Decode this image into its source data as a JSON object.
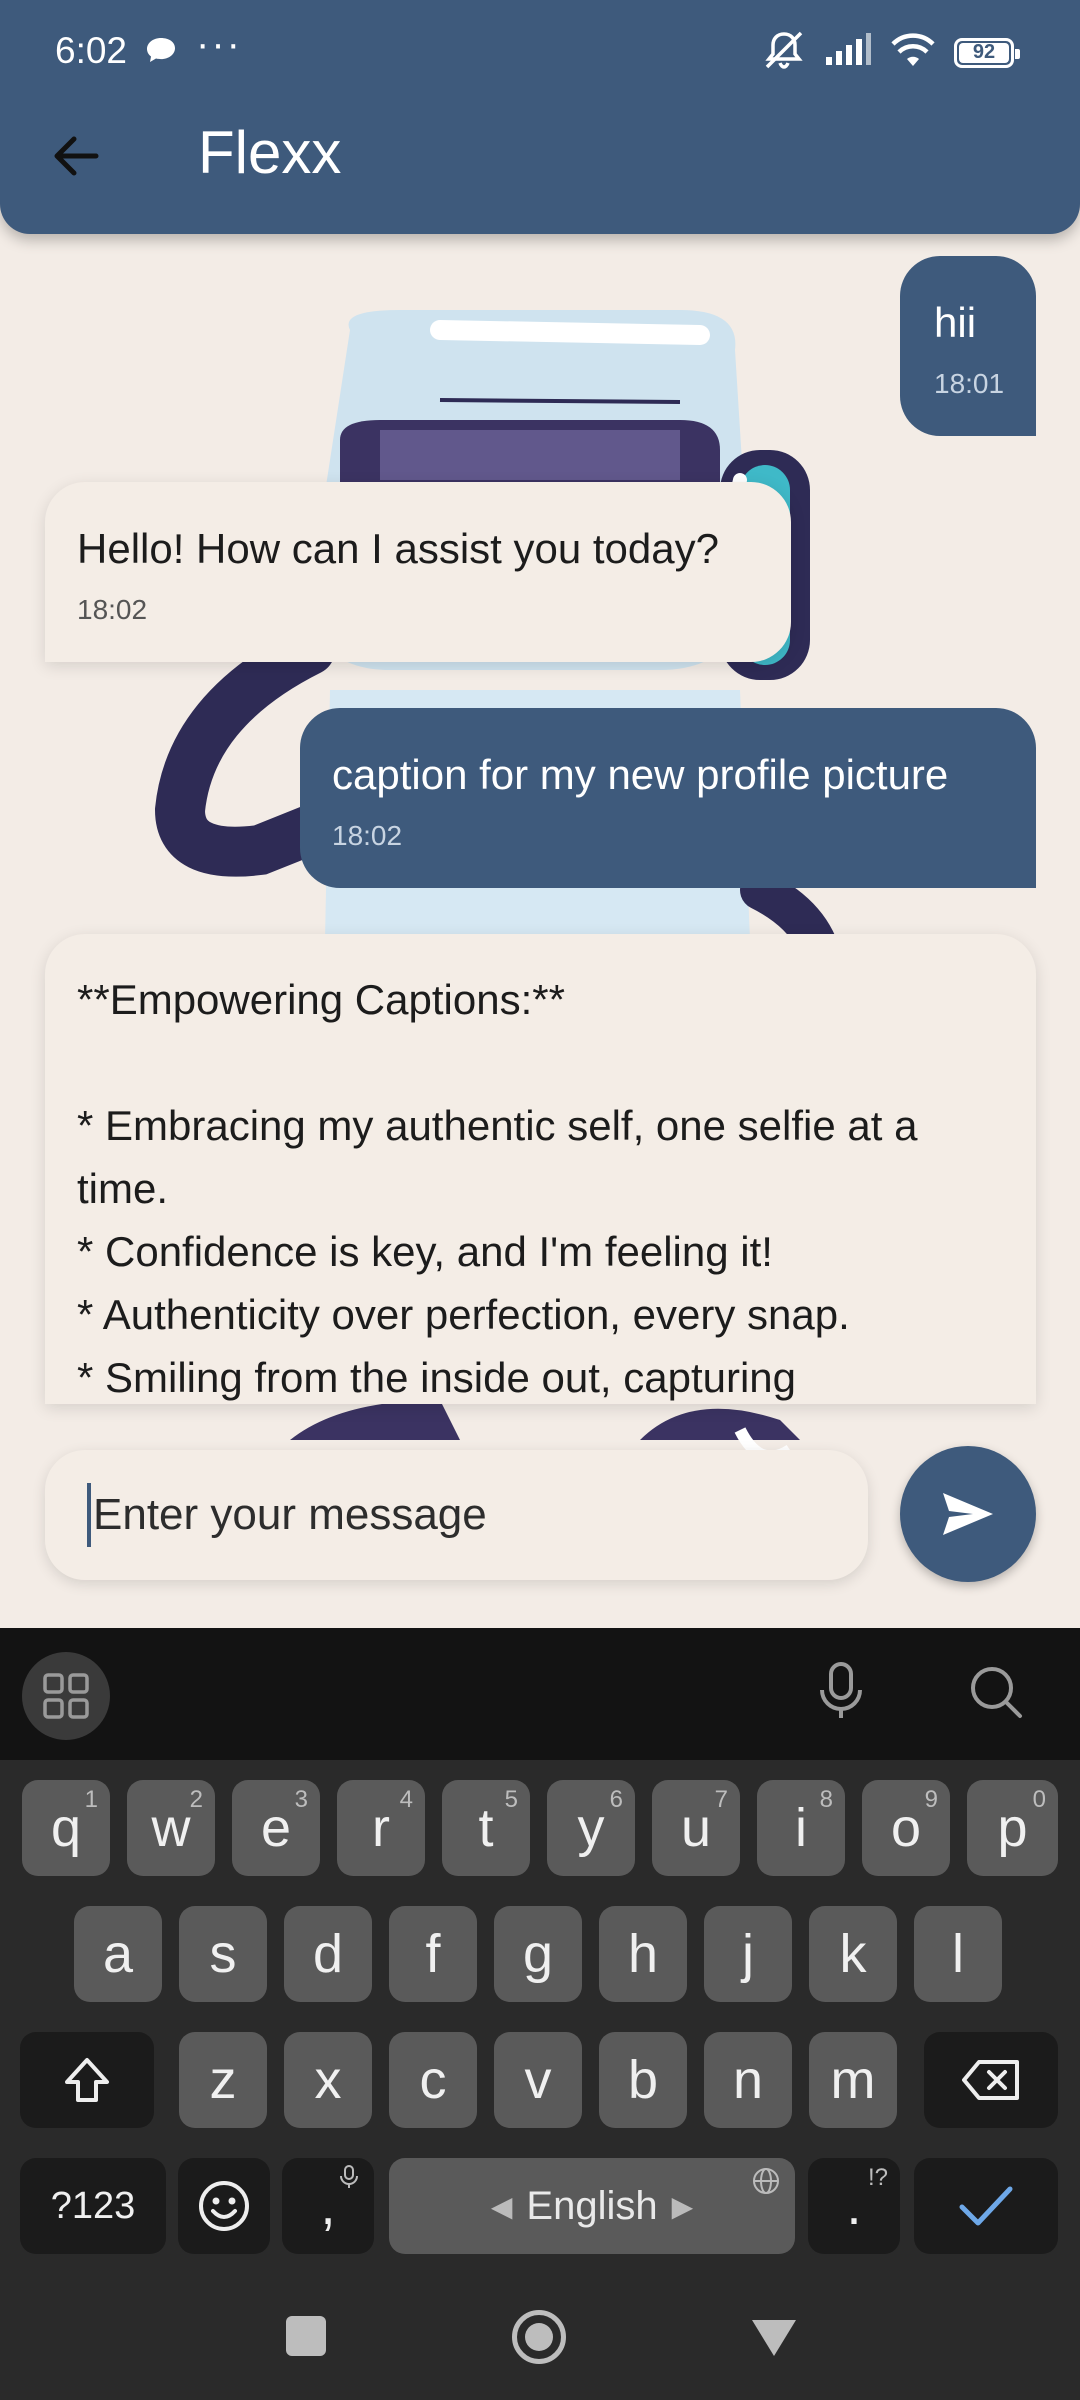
{
  "status_bar": {
    "time": "6:02",
    "dots": "···",
    "battery": "92"
  },
  "header": {
    "title": "Flexx"
  },
  "messages": [
    {
      "role": "user",
      "text": "hii",
      "time": "18:01"
    },
    {
      "role": "bot",
      "text": "Hello! How can I assist you today?",
      "time": "18:02"
    },
    {
      "role": "user",
      "text": "caption for my new profile picture",
      "time": "18:02"
    },
    {
      "role": "bot",
      "lines": [
        "**Empowering Captions:**",
        " ",
        "* Embracing my authentic self, one selfie at a",
        "time.",
        "* Confidence is key, and I'm feeling it!",
        "* Authenticity over perfection, every snap.",
        "* Smiling from the inside out, capturing"
      ]
    }
  ],
  "composer": {
    "placeholder": "Enter your message"
  },
  "keyboard": {
    "row1": [
      "q",
      "w",
      "e",
      "r",
      "t",
      "y",
      "u",
      "i",
      "o",
      "p"
    ],
    "row1_hints": [
      "1",
      "2",
      "3",
      "4",
      "5",
      "6",
      "7",
      "8",
      "9",
      "0"
    ],
    "row2": [
      "a",
      "s",
      "d",
      "f",
      "g",
      "h",
      "j",
      "k",
      "l"
    ],
    "row3": [
      "z",
      "x",
      "c",
      "v",
      "b",
      "n",
      "m"
    ],
    "symbols_label": "?123",
    "comma": ",",
    "space_label": "English",
    "period": ".",
    "period_hint": "!?",
    "accent_color": "#6ea8e8"
  }
}
